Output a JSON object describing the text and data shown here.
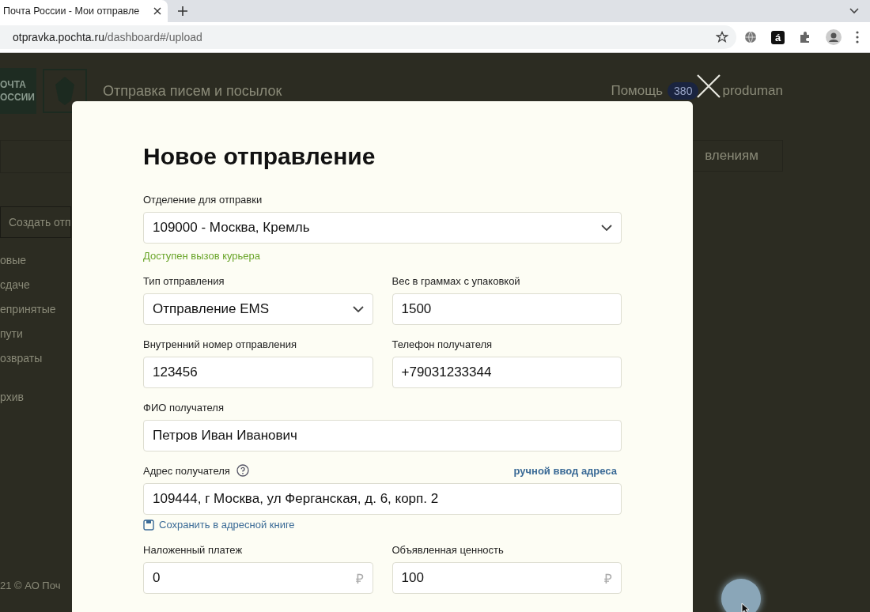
{
  "browser": {
    "tab_title": "Почта России - Мои отправле",
    "url_host": "otpravka.pochta.ru",
    "url_path": "/dashboard#/upload",
    "ext_letter": "á"
  },
  "background": {
    "logo_lines": [
      "ОЧТА",
      "ОССИИ"
    ],
    "header_title": "Отправка писем и посылок",
    "help": "Помощь",
    "badge": "380",
    "user": "produman",
    "sort_label": "влениям",
    "create_button": "Создать отп",
    "nav": [
      {
        "label": "овые"
      },
      {
        "label": "сдаче"
      },
      {
        "label": "епринятые"
      },
      {
        "label": "пути"
      },
      {
        "label": "озвраты"
      }
    ],
    "archive": "рхив",
    "footer": "21 © АО Поч"
  },
  "modal": {
    "title": "Новое отправление",
    "rows": [
      [
        {
          "kind": "select",
          "label": "Отделение для отправки",
          "value": "109000 - Москва, Кремль",
          "hint": "Доступен вызов курьера"
        }
      ],
      [
        {
          "kind": "select",
          "label": "Тип отправления",
          "value": "Отправление EMS"
        },
        {
          "kind": "input",
          "label": "Вес в граммах с упаковкой",
          "value": "1500"
        }
      ],
      [
        {
          "kind": "input",
          "label": "Внутренний номер отправления",
          "value": "123456"
        },
        {
          "kind": "input",
          "label": "Телефон получателя",
          "value": "+79031233344"
        }
      ],
      [
        {
          "kind": "input",
          "label": "ФИО получателя",
          "value": "Петров Иван Иванович"
        }
      ],
      [
        {
          "kind": "input",
          "label": "Адрес получателя",
          "help": true,
          "link": "ручной ввод адреса",
          "value": "109444, г Москва, ул Ферганская, д. 6, корп. 2",
          "action": "Сохранить в адресной книге"
        }
      ],
      [
        {
          "kind": "money",
          "label": "Наложенный платеж",
          "value": "0",
          "currency": "₽"
        },
        {
          "kind": "money",
          "label": "Объявленная ценность",
          "value": "100",
          "currency": "₽"
        }
      ]
    ]
  }
}
